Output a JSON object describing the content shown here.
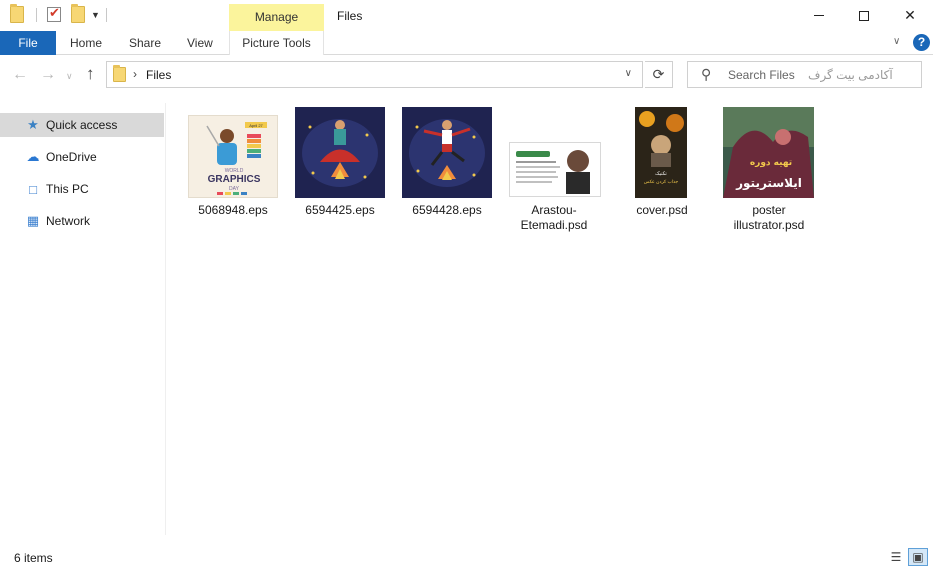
{
  "window": {
    "title": "Files",
    "contextual_tab": "Manage",
    "contextual_group": "Picture Tools"
  },
  "ribbon": {
    "tabs": [
      "File",
      "Home",
      "Share",
      "View"
    ]
  },
  "address": {
    "path": "Files",
    "search_placeholder": "Search Files",
    "watermark": "آکادمی بیت گرف"
  },
  "sidebar": {
    "items": [
      {
        "label": "Quick access",
        "icon": "star-icon",
        "selected": true
      },
      {
        "label": "OneDrive",
        "icon": "cloud-icon",
        "selected": false
      },
      {
        "label": "This PC",
        "icon": "computer-icon",
        "selected": false
      },
      {
        "label": "Network",
        "icon": "network-icon",
        "selected": false
      }
    ]
  },
  "files": [
    {
      "name": "5068948.eps"
    },
    {
      "name": "6594425.eps"
    },
    {
      "name": "6594428.eps"
    },
    {
      "name": "Arastou-Etemadi.psd"
    },
    {
      "name": "cover.psd"
    },
    {
      "name": "poster illustrator.psd"
    }
  ],
  "thumbnail_text": {
    "graphics": "GRAPHICS",
    "day": "DAY",
    "world": "WORLD",
    "april": "April 27",
    "poster_main": "ایلاستریتور",
    "poster_top": "تهیه دوره",
    "cover_line1": "تکنیک",
    "cover_line2": "جذاب کردن عکس"
  },
  "status": {
    "item_count": "6 items"
  },
  "colors": {
    "accent": "#1a67b8",
    "manage_highlight": "#fbf49c",
    "selection": "#d9d9d9"
  }
}
